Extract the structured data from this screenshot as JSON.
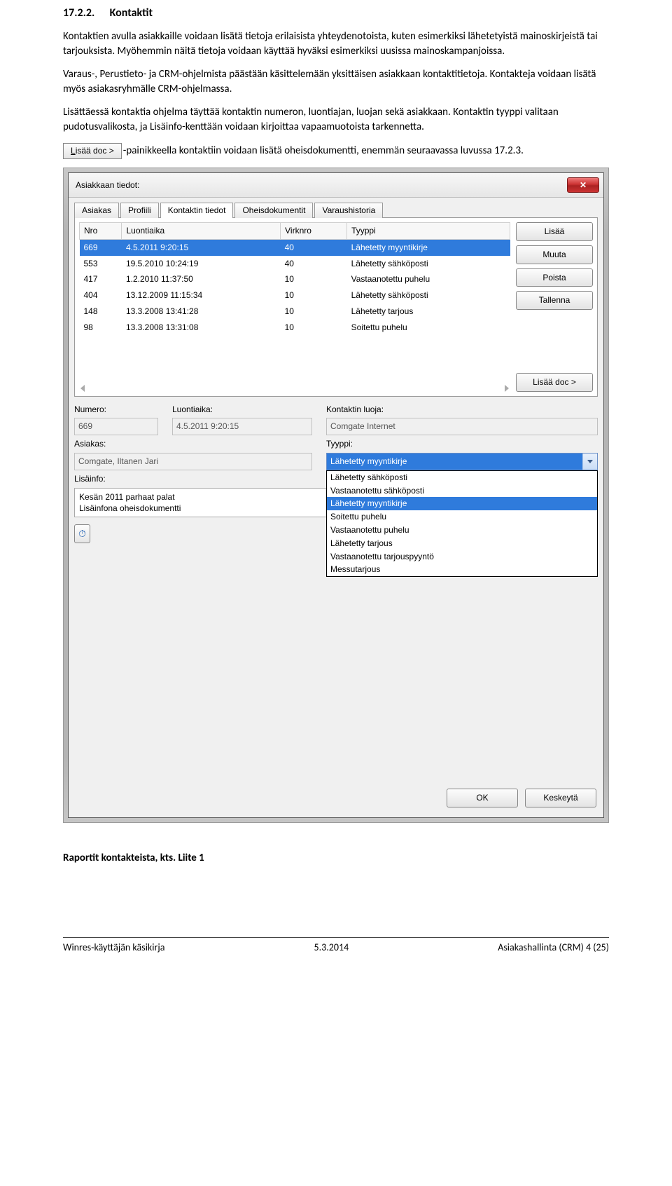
{
  "heading": {
    "number": "17.2.2.",
    "title": "Kontaktit"
  },
  "paras": {
    "p1": "Kontaktien avulla asiakkaille voidaan lisätä tietoja erilaisista yhteydenotoista, kuten esimerkiksi lähetetyistä mainoskirjeistä tai tarjouksista. Myöhemmin näitä tietoja voidaan käyttää hyväksi esimerkiksi uusissa mainoskampanjoissa.",
    "p2": "Varaus-, Perustieto- ja CRM-ohjelmista päästään käsittelemään yksittäisen asiakkaan kontaktitietoja. Kontakteja voidaan lisätä myös asiakasryhmälle CRM-ohjelmassa.",
    "p3": "Lisättäessä kontaktia ohjelma täyttää kontaktin numeron, luontiajan, luojan sekä asiakkaan. Kontaktin tyyppi valitaan pudotusvalikosta, ja Lisäinfo-kenttään voidaan kirjoittaa vapaamuotoista tarkennetta.",
    "p4_button": "Lisää doc >",
    "p4_tail": "-painikkeella kontaktiin voidaan lisätä oheisdokumentti, enemmän seuraavassa luvussa 17.2.3.",
    "p5": "Raportit kontakteista, kts. Liite 1"
  },
  "window": {
    "title": "Asiakkaan tiedot:",
    "close": "✕",
    "tabs": [
      "Asiakas",
      "Profiili",
      "Kontaktin tiedot",
      "Oheisdokumentit",
      "Varaushistoria"
    ],
    "active_tab": 2,
    "headers": [
      "Nro",
      "Luontiaika",
      "Virknro",
      "Tyyppi"
    ],
    "rows": [
      {
        "nro": "669",
        "aika": "4.5.2011 9:20:15",
        "virk": "40",
        "tyyppi": "Lähetetty myyntikirje",
        "selected": true
      },
      {
        "nro": "553",
        "aika": "19.5.2010 10:24:19",
        "virk": "40",
        "tyyppi": "Lähetetty sähköposti"
      },
      {
        "nro": "417",
        "aika": "1.2.2010 11:37:50",
        "virk": "10",
        "tyyppi": "Vastaanotettu puhelu"
      },
      {
        "nro": "404",
        "aika": "13.12.2009 11:15:34",
        "virk": "10",
        "tyyppi": "Lähetetty sähköposti"
      },
      {
        "nro": "148",
        "aika": "13.3.2008 13:41:28",
        "virk": "10",
        "tyyppi": "Lähetetty tarjous"
      },
      {
        "nro": "98",
        "aika": "13.3.2008 13:31:08",
        "virk": "10",
        "tyyppi": "Soitettu puhelu"
      }
    ],
    "side_buttons": {
      "add": "Lisää",
      "edit": "Muuta",
      "del": "Poista",
      "save": "Tallenna",
      "doc": "Lisää doc >"
    },
    "labels": {
      "numero": "Numero:",
      "luontiaika": "Luontiaika:",
      "luoja": "Kontaktin luoja:",
      "asiakas": "Asiakas:",
      "tyyppi": "Tyyppi:",
      "lisainfo": "Lisäinfo:"
    },
    "values": {
      "numero": "669",
      "luontiaika": "4.5.2011 9:20:15",
      "luoja": "Comgate Internet",
      "asiakas": "Comgate, Iltanen Jari",
      "tyyppi_sel": "Lähetetty myyntikirje",
      "lisainfo": "Kesän 2011 parhaat palat\nLisäinfona oheisdokumentti"
    },
    "tyyppi_options": [
      "Lähetetty sähköposti",
      "Vastaanotettu sähköposti",
      "Lähetetty myyntikirje",
      "Soitettu puhelu",
      "Vastaanotettu puhelu",
      "Lähetetty tarjous",
      "Vastaanotettu tarjouspyyntö",
      "Messutarjous"
    ],
    "footer_buttons": {
      "ok": "OK",
      "cancel": "Keskeytä"
    },
    "stopwatch_glyph": "⏱"
  },
  "footer": {
    "left": "Winres-käyttäjän käsikirja",
    "center": "5.3.2014",
    "right": "Asiakashallinta (CRM)  4 (25)"
  }
}
